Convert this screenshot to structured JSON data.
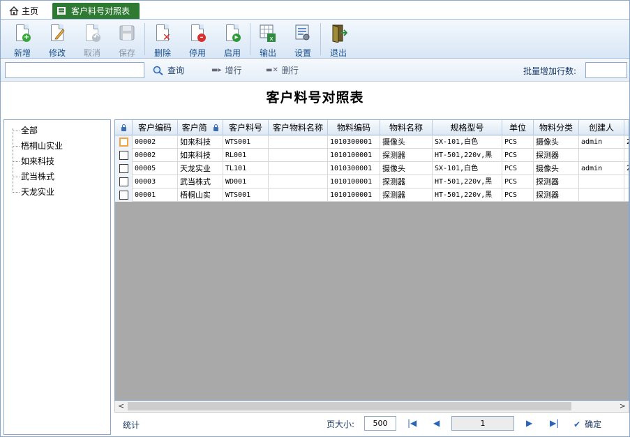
{
  "tabs": {
    "home_label": "主页",
    "active_label": "客户料号对照表"
  },
  "toolbar": {
    "buttons": [
      {
        "label": "新增",
        "icon": "add-doc-icon",
        "enabled": true
      },
      {
        "label": "修改",
        "icon": "edit-doc-icon",
        "enabled": true
      },
      {
        "label": "取消",
        "icon": "undo-doc-icon",
        "enabled": false
      },
      {
        "label": "保存",
        "icon": "save-disk-icon",
        "enabled": false
      },
      {
        "label": "删除",
        "icon": "delete-doc-icon",
        "enabled": true
      },
      {
        "label": "停用",
        "icon": "disable-doc-icon",
        "enabled": true
      },
      {
        "label": "启用",
        "icon": "enable-doc-icon",
        "enabled": true
      },
      {
        "label": "输出",
        "icon": "export-excel-icon",
        "enabled": true
      },
      {
        "label": "设置",
        "icon": "settings-icon",
        "enabled": true
      },
      {
        "label": "退出",
        "icon": "exit-door-icon",
        "enabled": true
      }
    ]
  },
  "search": {
    "value": "",
    "query_label": "查询",
    "add_row_label": "增行",
    "delete_row_label": "删行",
    "batch_label": "批量增加行数:",
    "batch_value": ""
  },
  "page": {
    "title": "客户料号对照表"
  },
  "tree": {
    "items": [
      "全部",
      "梧桐山实业",
      "如来科技",
      "武当株式",
      "天龙实业"
    ]
  },
  "grid": {
    "columns": [
      "客户编码",
      "客户简",
      "客户料号",
      "客户物料名称",
      "物料编码",
      "物料名称",
      "规格型号",
      "单位",
      "物料分类",
      "创建人"
    ],
    "rows": [
      [
        "00002",
        "如来科技",
        "WTS001",
        "",
        "1010300001",
        "摄像头",
        "SX-101,白色",
        "PCS",
        "摄像头",
        "admin",
        "2"
      ],
      [
        "00002",
        "如来科技",
        "RL001",
        "",
        "1010100001",
        "探测器",
        "HT-501,220v,黑",
        "PCS",
        "探测器",
        "",
        ""
      ],
      [
        "00005",
        "天龙实业",
        "TL101",
        "",
        "1010300001",
        "摄像头",
        "SX-101,白色",
        "PCS",
        "摄像头",
        "admin",
        "2"
      ],
      [
        "00003",
        "武当株式",
        "WD001",
        "",
        "1010100001",
        "探测器",
        "HT-501,220v,黑",
        "PCS",
        "探测器",
        "",
        ""
      ],
      [
        "00001",
        "梧桐山实",
        "WTS001",
        "",
        "1010100001",
        "探测器",
        "HT-501,220v,黑",
        "PCS",
        "探测器",
        "",
        ""
      ]
    ]
  },
  "footer": {
    "stat_label": "统计",
    "page_size_label": "页大小:",
    "page_size_value": "500",
    "current_page": "1",
    "confirm_label": "确定"
  }
}
